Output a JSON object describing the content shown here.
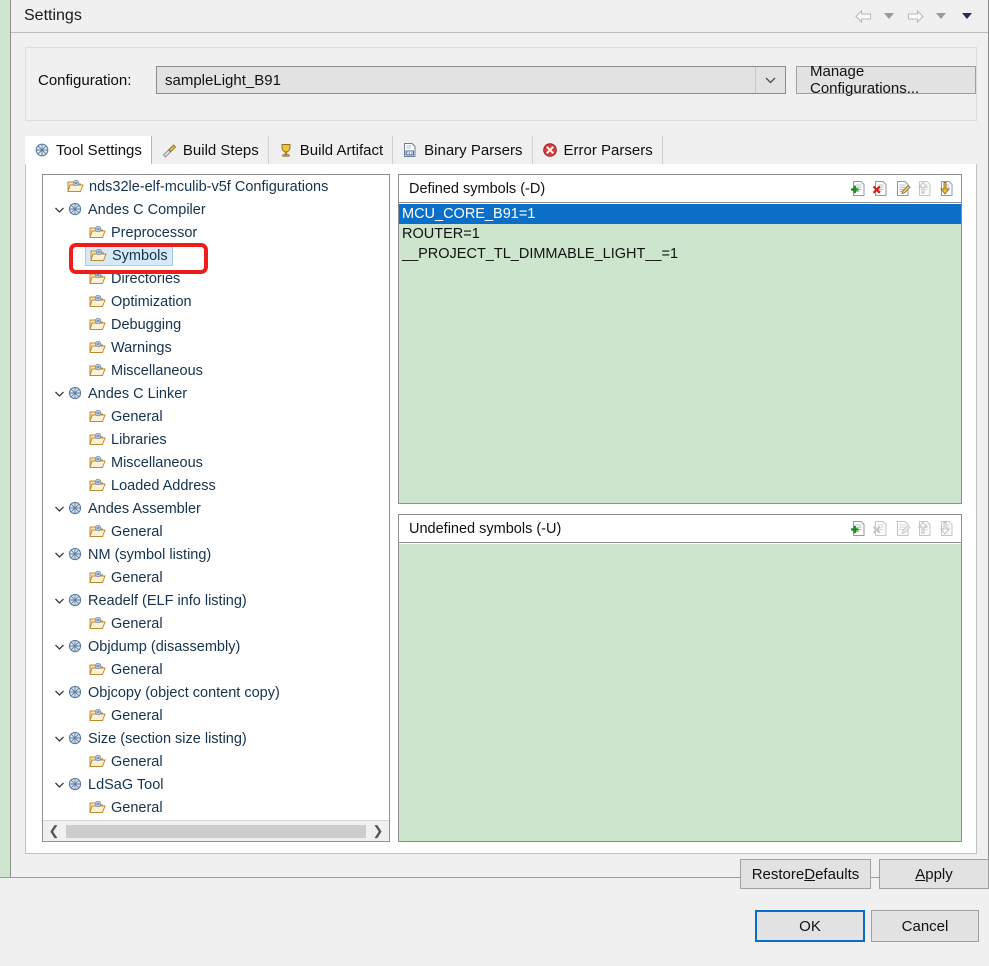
{
  "window": {
    "title": "Settings",
    "nav": {
      "back_icon": "back-arrow-icon",
      "back_dropdown_icon": "chevron-down-icon",
      "forward_icon": "forward-arrow-icon",
      "forward_dropdown_icon": "chevron-down-icon",
      "menu_dropdown_icon": "chevron-down-icon"
    }
  },
  "config": {
    "label": "Configuration:",
    "value": "sampleLight_B91",
    "dropdown_icon": "chevron-down-icon",
    "manage_button": "Manage Configurations..."
  },
  "tabs": [
    {
      "label": "Tool Settings",
      "icon": "tool-settings-icon",
      "active": true
    },
    {
      "label": "Build Steps",
      "icon": "build-steps-icon",
      "active": false
    },
    {
      "label": "Build Artifact",
      "icon": "build-artifact-icon",
      "active": false
    },
    {
      "label": "Binary Parsers",
      "icon": "binary-parsers-icon",
      "active": false
    },
    {
      "label": "Error Parsers",
      "icon": "error-parsers-icon",
      "active": false
    }
  ],
  "tree": [
    {
      "label": "nds32le-elf-mculib-v5f Configurations",
      "indent": 0,
      "icon": "folder-icon",
      "expander": "none",
      "selected": false
    },
    {
      "label": "Andes C Compiler",
      "indent": 0,
      "icon": "tool-icon",
      "expander": "expanded",
      "selected": false
    },
    {
      "label": "Preprocessor",
      "indent": 1,
      "icon": "folder-icon",
      "expander": "none",
      "selected": false
    },
    {
      "label": "Symbols",
      "indent": 1,
      "icon": "folder-icon",
      "expander": "none",
      "selected": true
    },
    {
      "label": "Directories",
      "indent": 1,
      "icon": "folder-icon",
      "expander": "none",
      "selected": false
    },
    {
      "label": "Optimization",
      "indent": 1,
      "icon": "folder-icon",
      "expander": "none",
      "selected": false
    },
    {
      "label": "Debugging",
      "indent": 1,
      "icon": "folder-icon",
      "expander": "none",
      "selected": false
    },
    {
      "label": "Warnings",
      "indent": 1,
      "icon": "folder-icon",
      "expander": "none",
      "selected": false
    },
    {
      "label": "Miscellaneous",
      "indent": 1,
      "icon": "folder-icon",
      "expander": "none",
      "selected": false
    },
    {
      "label": "Andes C Linker",
      "indent": 0,
      "icon": "tool-icon",
      "expander": "expanded",
      "selected": false
    },
    {
      "label": "General",
      "indent": 1,
      "icon": "folder-icon",
      "expander": "none",
      "selected": false
    },
    {
      "label": "Libraries",
      "indent": 1,
      "icon": "folder-icon",
      "expander": "none",
      "selected": false
    },
    {
      "label": "Miscellaneous",
      "indent": 1,
      "icon": "folder-icon",
      "expander": "none",
      "selected": false
    },
    {
      "label": "Loaded Address",
      "indent": 1,
      "icon": "folder-icon",
      "expander": "none",
      "selected": false
    },
    {
      "label": "Andes Assembler",
      "indent": 0,
      "icon": "tool-icon",
      "expander": "expanded",
      "selected": false
    },
    {
      "label": "General",
      "indent": 1,
      "icon": "folder-icon",
      "expander": "none",
      "selected": false
    },
    {
      "label": "NM (symbol listing)",
      "indent": 0,
      "icon": "tool-icon",
      "expander": "expanded",
      "selected": false
    },
    {
      "label": "General",
      "indent": 1,
      "icon": "folder-icon",
      "expander": "none",
      "selected": false
    },
    {
      "label": "Readelf (ELF info listing)",
      "indent": 0,
      "icon": "tool-icon",
      "expander": "expanded",
      "selected": false
    },
    {
      "label": "General",
      "indent": 1,
      "icon": "folder-icon",
      "expander": "none",
      "selected": false
    },
    {
      "label": "Objdump (disassembly)",
      "indent": 0,
      "icon": "tool-icon",
      "expander": "expanded",
      "selected": false
    },
    {
      "label": "General",
      "indent": 1,
      "icon": "folder-icon",
      "expander": "none",
      "selected": false
    },
    {
      "label": "Objcopy (object content copy)",
      "indent": 0,
      "icon": "tool-icon",
      "expander": "expanded",
      "selected": false
    },
    {
      "label": "General",
      "indent": 1,
      "icon": "folder-icon",
      "expander": "none",
      "selected": false
    },
    {
      "label": "Size (section size listing)",
      "indent": 0,
      "icon": "tool-icon",
      "expander": "expanded",
      "selected": false
    },
    {
      "label": "General",
      "indent": 1,
      "icon": "folder-icon",
      "expander": "none",
      "selected": false
    },
    {
      "label": "LdSaG Tool",
      "indent": 0,
      "icon": "tool-icon",
      "expander": "expanded",
      "selected": false
    },
    {
      "label": "General",
      "indent": 1,
      "icon": "folder-icon",
      "expander": "none",
      "selected": false
    }
  ],
  "tree_scrollbar": {
    "left_arrow_icon": "chevron-left-icon",
    "right_arrow_icon": "chevron-right-icon"
  },
  "panes": {
    "defined": {
      "title": "Defined symbols (-D)",
      "tools": [
        {
          "name": "add-icon",
          "enabled": true
        },
        {
          "name": "delete-icon",
          "enabled": true
        },
        {
          "name": "edit-icon",
          "enabled": true
        },
        {
          "name": "move-up-icon",
          "enabled": false
        },
        {
          "name": "move-down-icon",
          "enabled": true
        }
      ],
      "items": [
        {
          "value": "MCU_CORE_B91=1",
          "selected": true
        },
        {
          "value": "ROUTER=1",
          "selected": false
        },
        {
          "value": "__PROJECT_TL_DIMMABLE_LIGHT__=1",
          "selected": false
        }
      ]
    },
    "undefined": {
      "title": "Undefined symbols (-U)",
      "tools": [
        {
          "name": "add-icon",
          "enabled": true
        },
        {
          "name": "delete-icon",
          "enabled": false
        },
        {
          "name": "edit-icon",
          "enabled": false
        },
        {
          "name": "move-up-icon",
          "enabled": false
        },
        {
          "name": "move-down-icon",
          "enabled": false
        }
      ],
      "items": []
    }
  },
  "buttons": {
    "restore_defaults": {
      "pre": "Restore ",
      "mnemonic": "D",
      "post": "efaults"
    },
    "apply": {
      "pre": "",
      "mnemonic": "A",
      "post": "pply"
    },
    "ok": "OK",
    "cancel": "Cancel"
  },
  "colors": {
    "selection_blue": "#0b6fc7",
    "pane_background_green": "#cde5cd",
    "annotation_red": "#ef1c1c",
    "focus_blue": "#0a6cc4",
    "tree_selection": "#d6e9f8"
  }
}
